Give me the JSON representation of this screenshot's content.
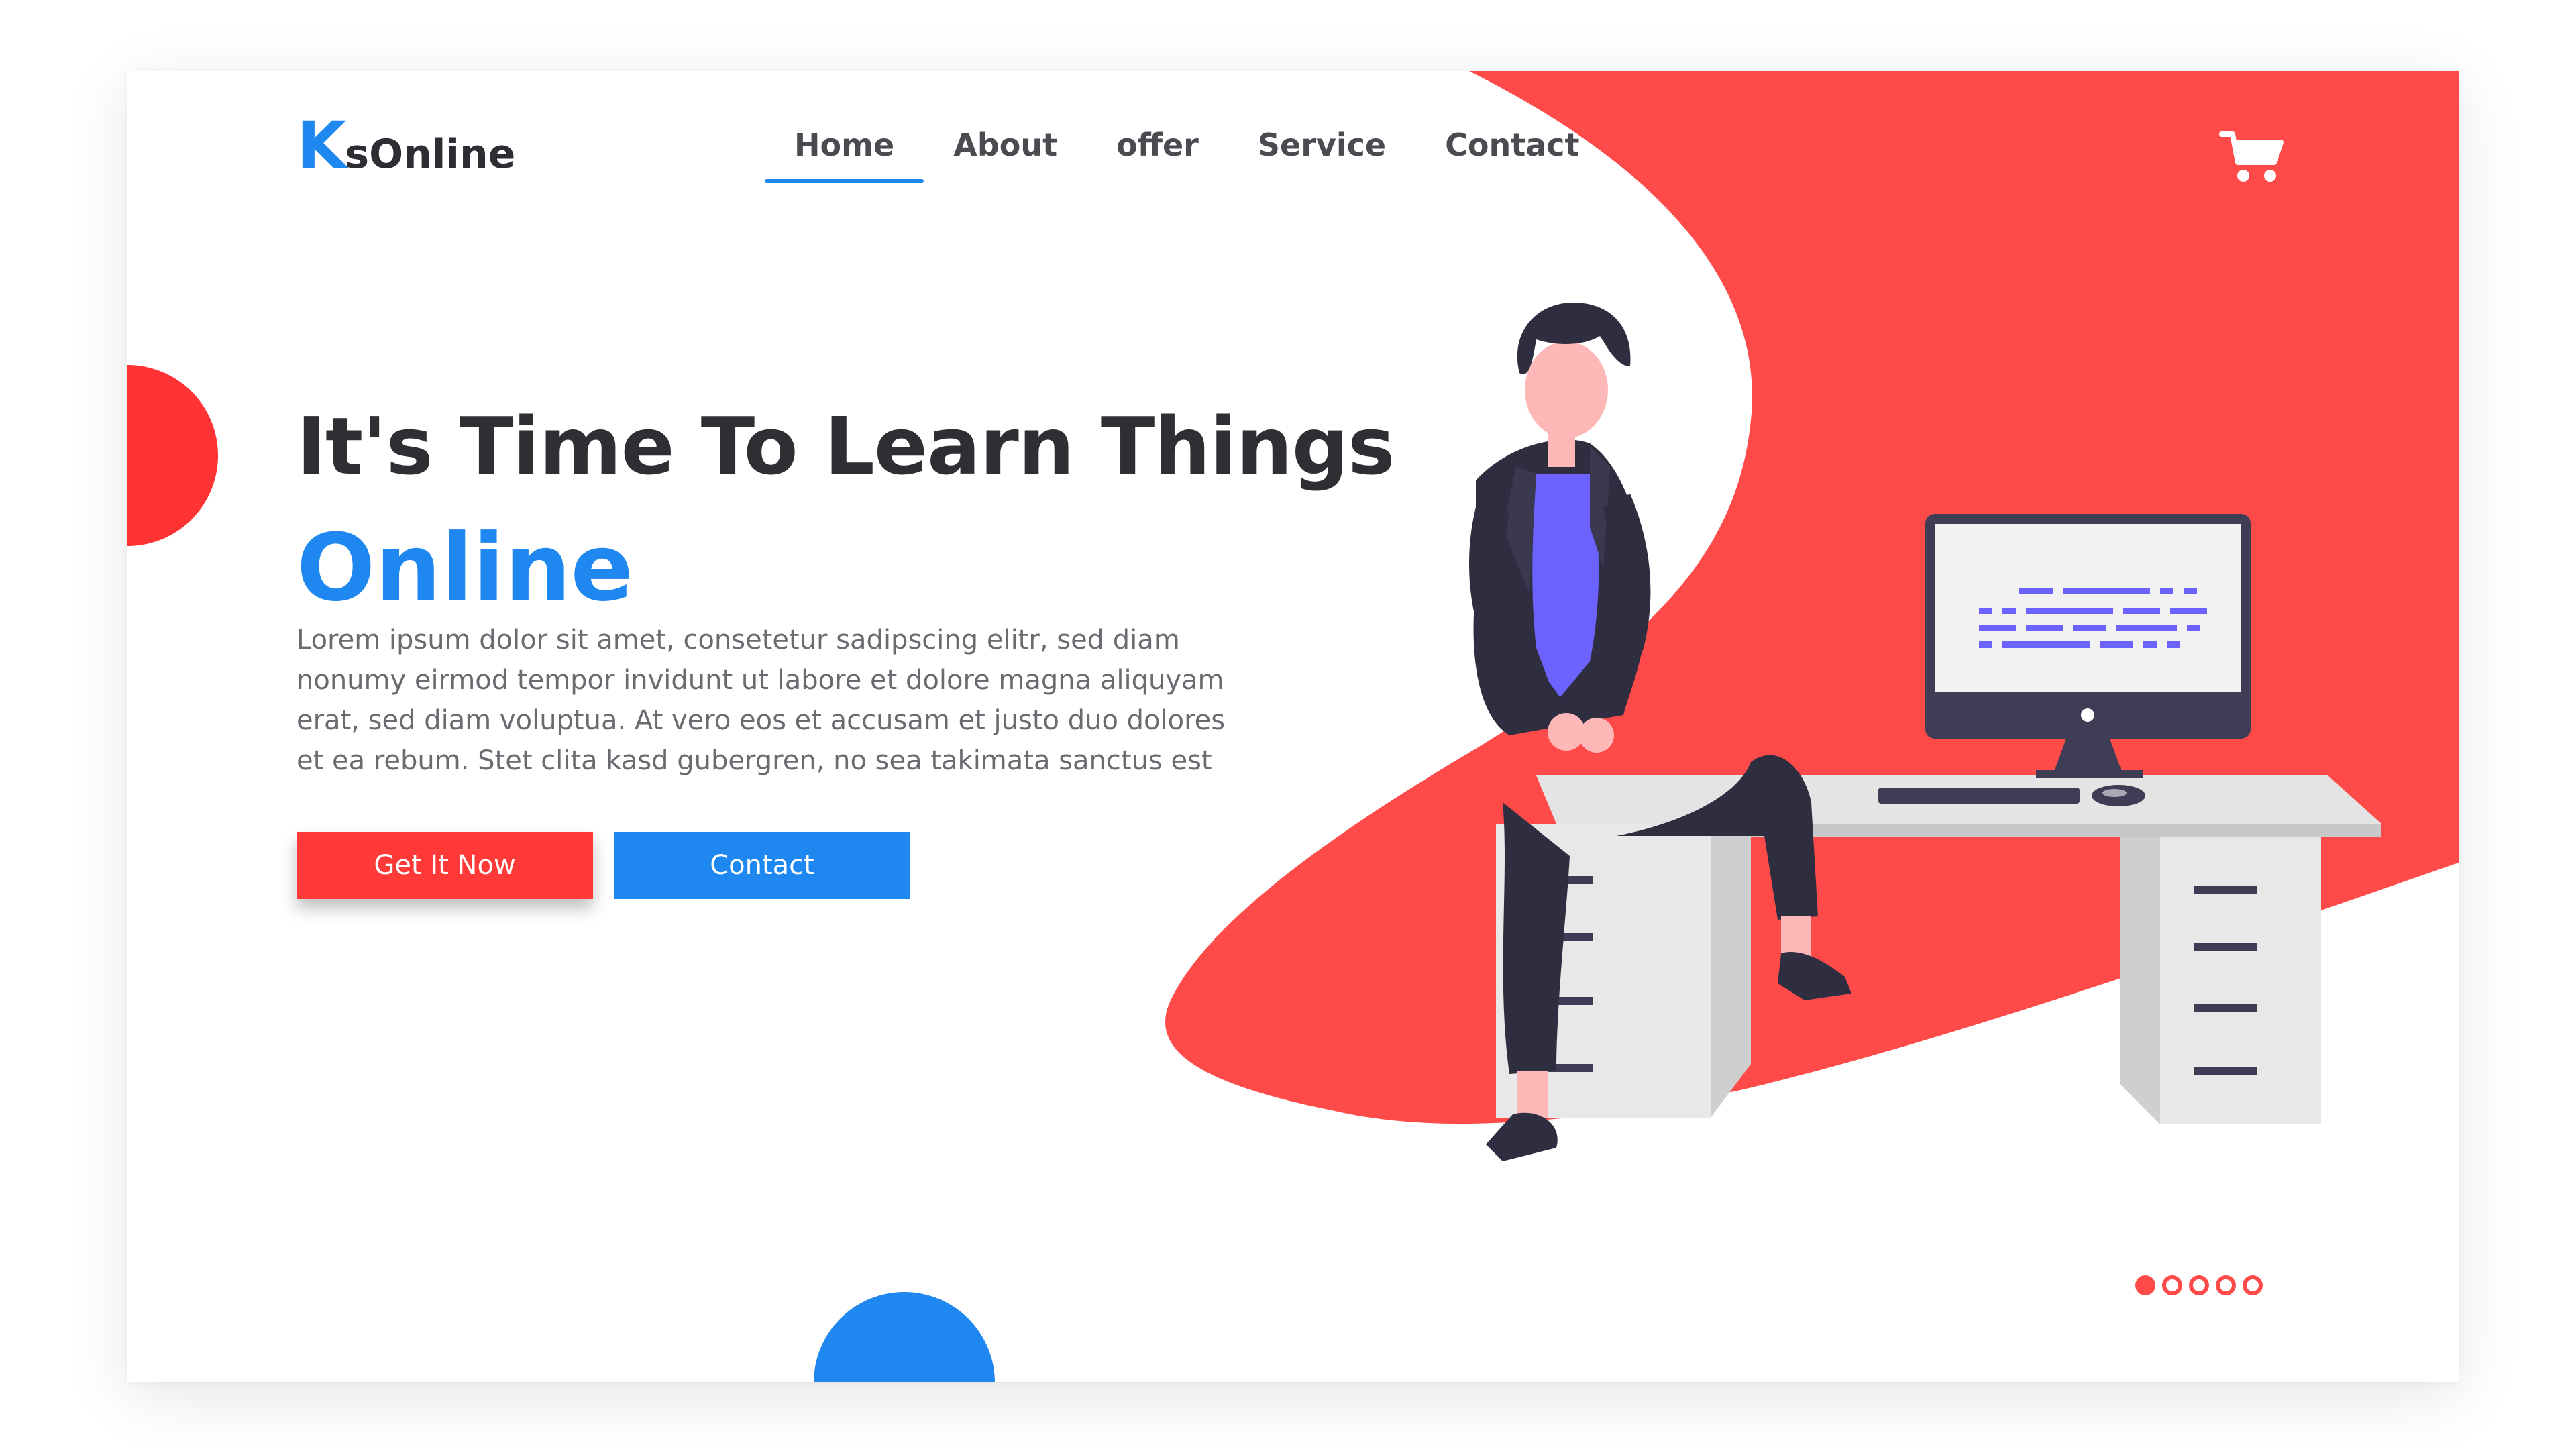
{
  "brand": {
    "logo_initial": "K",
    "logo_rest": "sOnline"
  },
  "nav": {
    "items": [
      {
        "label": "Home",
        "active": true
      },
      {
        "label": "About",
        "active": false
      },
      {
        "label": "offer",
        "active": false
      },
      {
        "label": "Service",
        "active": false
      },
      {
        "label": "Contact",
        "active": false
      }
    ]
  },
  "header": {
    "cart_icon": "shopping-cart-icon"
  },
  "hero": {
    "title": "It's Time To Learn Things",
    "accent": "Online",
    "body": "Lorem ipsum dolor sit amet, consetetur sadipscing elitr, sed diam nonumy eirmod tempor invidunt ut labore et dolore magna aliquyam erat, sed diam voluptua. At vero eos et accusam et justo duo dolores et ea rebum. Stet clita kasd gubergren, no sea takimata sanctus est",
    "primary_button": "Get It Now",
    "secondary_button": "Contact"
  },
  "carousel": {
    "slide_count": 5,
    "active_index": 0
  },
  "colors": {
    "accent_red": "#ff4a4a",
    "accent_blue": "#1e87f0",
    "text_dark": "#2e2e33",
    "text_muted": "#6a6a70"
  }
}
